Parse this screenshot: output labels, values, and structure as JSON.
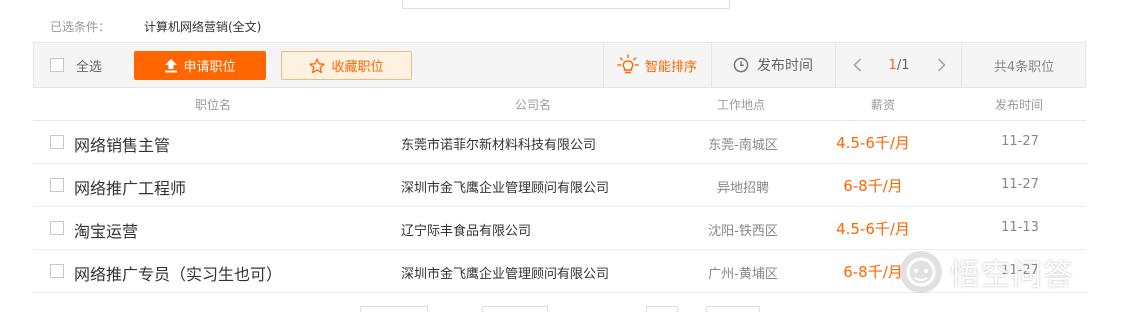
{
  "filter": {
    "label": "已选条件：",
    "value": "计算机网络营销(全文)"
  },
  "toolbar": {
    "select_all": "全选",
    "apply": "申请职位",
    "favorite": "收藏职位",
    "smart_sort": "智能排序",
    "publish_time": "发布时间",
    "page_current": "1",
    "page_total": "/1",
    "total_jobs": "共4条职位"
  },
  "columns": {
    "title": "职位名",
    "company": "公司名",
    "location": "工作地点",
    "salary": "薪资",
    "date": "发布时间"
  },
  "jobs": [
    {
      "title": "网络销售主管",
      "company": "东莞市诺菲尔新材料科技有限公司",
      "location": "东莞-南城区",
      "salary": "4.5-6千/月",
      "date": "11-27"
    },
    {
      "title": "网络推广工程师",
      "company": "深圳市金飞鹰企业管理顾问有限公司",
      "location": "异地招聘",
      "salary": "6-8千/月",
      "date": "11-27"
    },
    {
      "title": "淘宝运营",
      "company": "辽宁际丰食品有限公司",
      "location": "沈阳-铁西区",
      "salary": "4.5-6千/月",
      "date": "11-13"
    },
    {
      "title": "网络推广专员（实习生也可）",
      "company": "深圳市金飞鹰企业管理顾问有限公司",
      "location": "广州-黄埔区",
      "salary": "6-8千/月",
      "date": "11-27"
    }
  ],
  "watermark": {
    "text": "悟空问答"
  },
  "colors": {
    "accent": "#ff6600",
    "fav_bg": "#fff2e0",
    "toolbar_bg": "#f5f5f5"
  },
  "icons": [
    "upload-arrow-icon",
    "star-outline-icon",
    "lightbulb-icon",
    "clock-icon",
    "chevron-left-icon",
    "chevron-right-icon"
  ]
}
